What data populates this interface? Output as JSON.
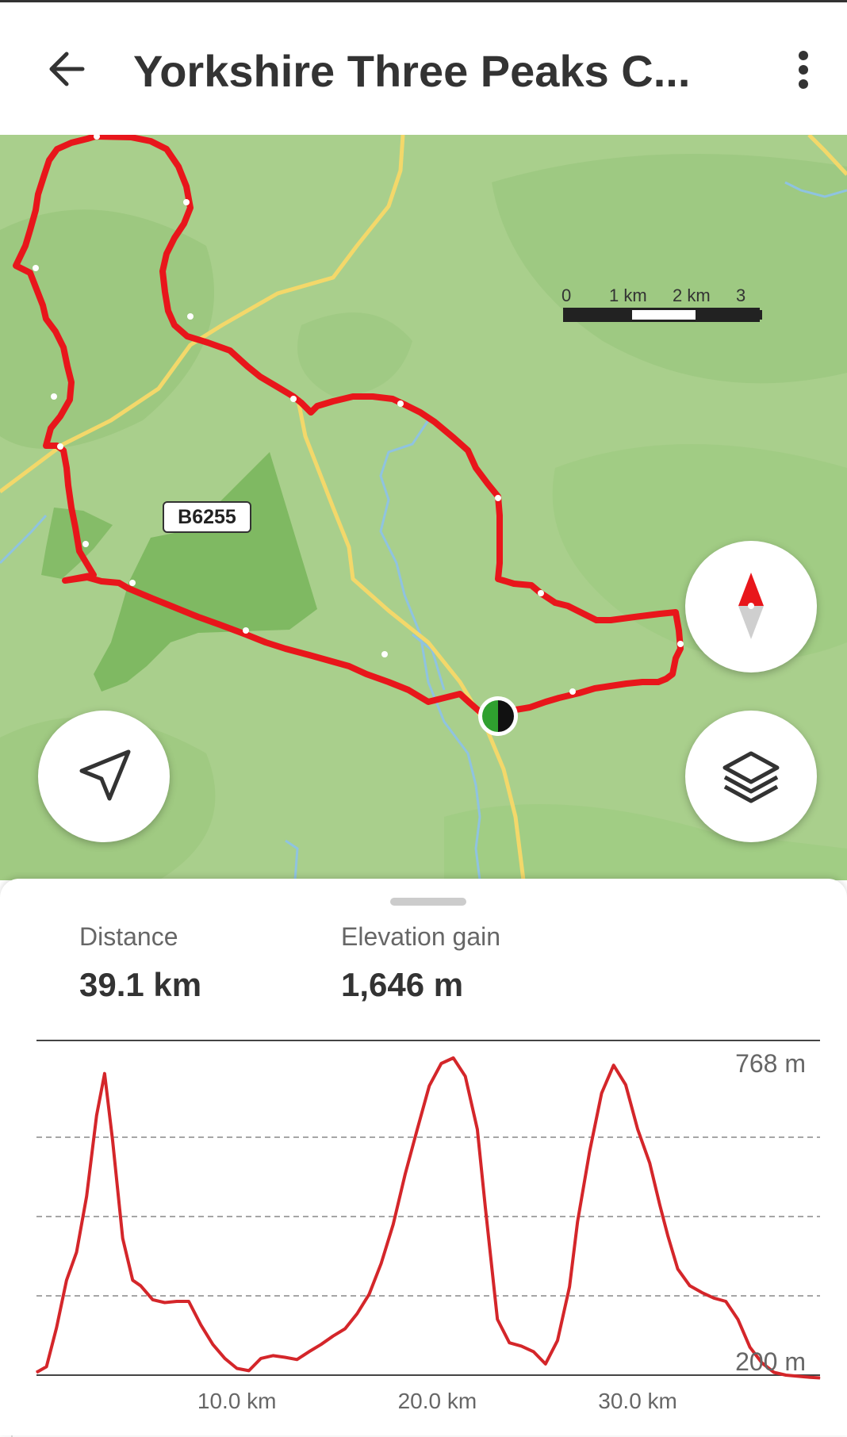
{
  "app_bar": {
    "title": "Yorkshire Three Peaks C...",
    "back_icon": "arrow-left-icon",
    "menu_icon": "more-vert-icon"
  },
  "map": {
    "road_label": "B6255",
    "scale": {
      "labels": [
        "0",
        "1 km",
        "2 km",
        "3 km"
      ]
    },
    "colors": {
      "route": "#e8161b",
      "road": "#f3d86a",
      "land": "#a9cf8c",
      "forest": "#7fb861",
      "water": "#8fc3e0"
    },
    "buttons": {
      "compass_icon": "compass-icon",
      "locate_icon": "navigation-arrow-icon",
      "layers_icon": "layers-icon"
    }
  },
  "stats": {
    "distance_label": "Distance",
    "distance_value": "39.1 km",
    "elevation_label": "Elevation gain",
    "elevation_value": "1,646 m"
  },
  "chart_data": {
    "type": "area",
    "title": "",
    "xlabel": "",
    "ylabel": "",
    "x_unit": "km",
    "y_unit": "m",
    "xlim": [
      0,
      39.1
    ],
    "ylim": [
      200,
      768
    ],
    "y_labels": [
      "768 m",
      "200 m"
    ],
    "x_tick_labels": [
      "10.0 km",
      "20.0 km",
      "30.0 km"
    ],
    "x_ticks": [
      10,
      20,
      30
    ],
    "grid": true,
    "color": "#d4262a",
    "series": [
      {
        "x": [
          0,
          0.5,
          1.0,
          1.5,
          2.0,
          2.5,
          3.0,
          3.4,
          3.8,
          4.3,
          4.8,
          5.2,
          5.8,
          6.4,
          7.0,
          7.6,
          8.2,
          8.8,
          9.4,
          10.0,
          10.6,
          11.2,
          11.8,
          12.4,
          13.0,
          13.6,
          14.2,
          14.8,
          15.4,
          16.0,
          16.6,
          17.2,
          17.8,
          18.4,
          19.0,
          19.6,
          20.2,
          20.8,
          21.4,
          22.0,
          22.4,
          23.0,
          23.6,
          24.2,
          24.8,
          25.4,
          26.0,
          26.6,
          27.0,
          27.6,
          28.2,
          28.8,
          29.4,
          30.0,
          30.6,
          31.1,
          31.5,
          32.0,
          32.6,
          33.2,
          33.8,
          34.4,
          35.0,
          35.6,
          36.2,
          36.8,
          37.4,
          38.0,
          38.6,
          39.1
        ],
        "y": [
          205,
          215,
          285,
          370,
          420,
          520,
          665,
          740,
          620,
          445,
          370,
          360,
          335,
          330,
          332,
          332,
          290,
          255,
          230,
          212,
          208,
          230,
          235,
          232,
          228,
          242,
          255,
          270,
          283,
          310,
          345,
          400,
          470,
          560,
          640,
          718,
          758,
          768,
          735,
          640,
          500,
          300,
          258,
          252,
          242,
          220,
          262,
          358,
          475,
          600,
          705,
          755,
          720,
          640,
          580,
          505,
          450,
          390,
          360,
          348,
          338,
          332,
          300,
          250,
          222,
          205,
          200,
          198,
          196,
          195
        ]
      }
    ]
  }
}
